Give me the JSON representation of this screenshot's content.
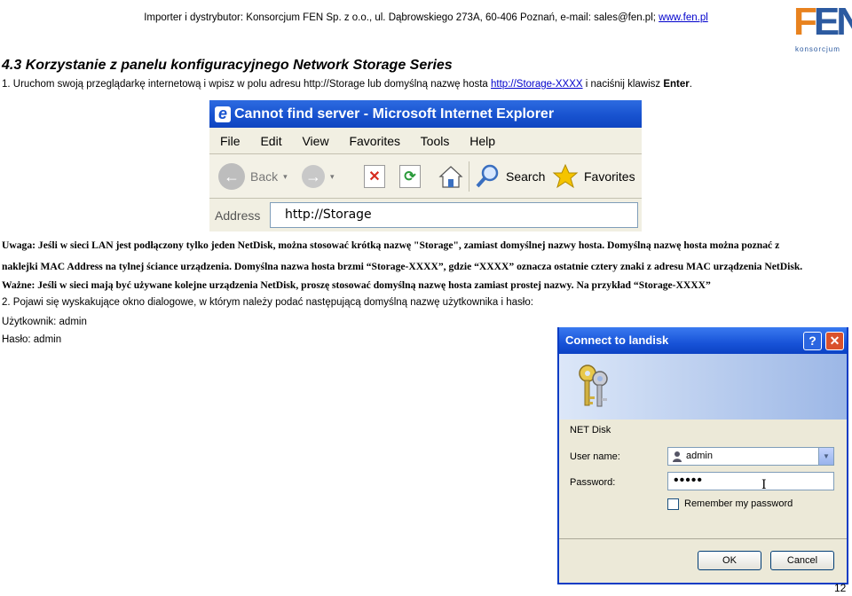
{
  "header": {
    "text": "Importer i dystrybutor: Konsorcjum FEN Sp. z o.o., ul. Dąbrowskiego 273A, 60-406 Poznań, e-mail: sales@fen.pl; ",
    "link": "www.fen.pl"
  },
  "logo": {
    "letters_f": "F",
    "letters_en": "EN",
    "sub": "konsorcjum"
  },
  "section": {
    "title": "4.3 Korzystanie z panelu konfiguracyjnego Network Storage Series",
    "step1_pre": "1. Uruchom swoją przeglądarkę internetową i wpisz w polu adresu http://Storage lub domyślną nazwę hosta ",
    "step1_link": "http://Storage-XXXX",
    "step1_post": " i naciśnij klawisz ",
    "step1_key": "Enter",
    "step1_end": "."
  },
  "ie_window": {
    "title": "Cannot find server - Microsoft Internet Explorer",
    "menu": [
      "File",
      "Edit",
      "View",
      "Favorites",
      "Tools",
      "Help"
    ],
    "back_label": "Back",
    "search_label": "Search",
    "favorites_label": "Favorites",
    "address_label": "Address",
    "address_value": "http://Storage"
  },
  "notes": {
    "note1": "Uwaga: Jeśli w sieci LAN jest podłączony tylko jeden NetDisk, można stosować krótką nazwę \"Storage\", zamiast domyślnej nazwy hosta. Domyślną nazwę hosta można poznać z",
    "note2": "naklejki MAC Address na tylnej ściance urządzenia. Domyślna nazwa hosta brzmi “Storage-XXXX”, gdzie “XXXX” oznacza ostatnie cztery znaki z adresu MAC urządzenia NetDisk.",
    "note3": "Ważne: Jeśli w sieci mają być używane kolejne urządzenia NetDisk, proszę stosować domyślną nazwę hosta zamiast prostej nazwy. Na przykład “Storage-XXXX”"
  },
  "step2": {
    "text": "2. Pojawi się wyskakujące okno dialogowe, w którym należy podać następującą domyślną nazwę użytkownika i hasło:",
    "user": "Użytkownik: admin",
    "pass": "Hasło: admin"
  },
  "dialog": {
    "title": "Connect to landisk",
    "help": "?",
    "close": "✕",
    "server": "NET Disk",
    "user_label": "User name:",
    "user_value": "admin",
    "pass_label": "Password:",
    "pass_value": "•••••",
    "remember": "Remember my password",
    "ok": "OK",
    "cancel": "Cancel"
  },
  "page_number": "12",
  "colors": {
    "link": "#0000cc",
    "xp_title": "#1853d0",
    "logo_orange": "#e8821e",
    "logo_blue": "#2c5aa0"
  }
}
